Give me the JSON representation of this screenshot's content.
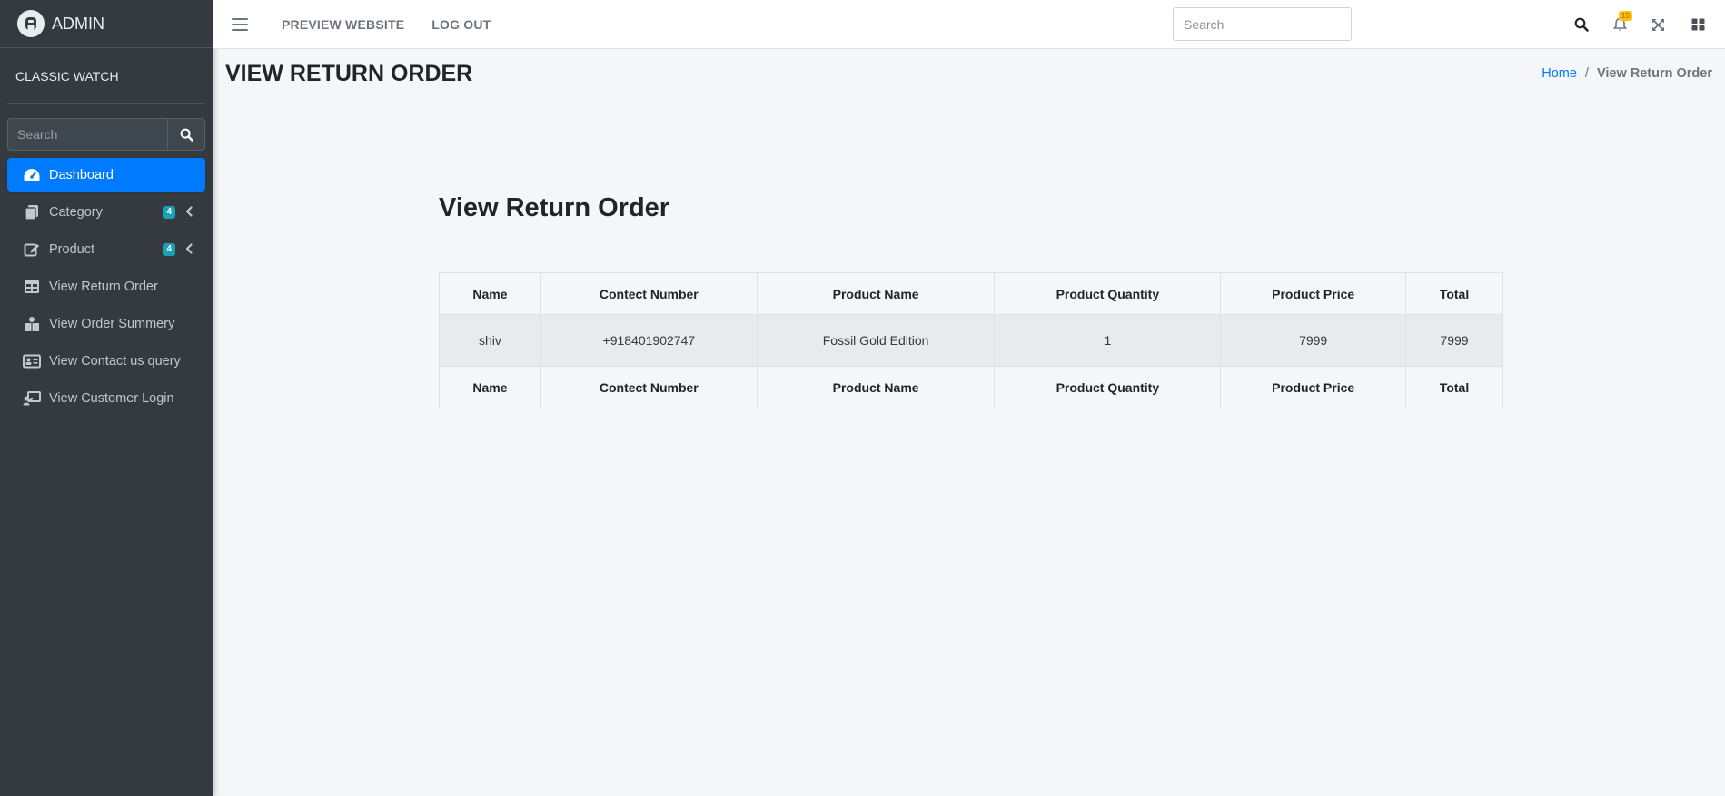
{
  "sidebar": {
    "brand": "ADMIN",
    "user": "CLASSIC WATCH",
    "search_placeholder": "Search",
    "items": [
      {
        "label": "Dashboard",
        "icon": "tachometer-icon",
        "active": true
      },
      {
        "label": "Category",
        "icon": "copy-icon",
        "badge": "4"
      },
      {
        "label": "Product",
        "icon": "edit-icon",
        "badge": "4"
      },
      {
        "label": "View Return Order",
        "icon": "table-icon"
      },
      {
        "label": "View Order Summery",
        "icon": "boxes-icon"
      },
      {
        "label": "View Contact us query",
        "icon": "address-card-icon"
      },
      {
        "label": "View Customer Login",
        "icon": "chalkboard-teacher-icon"
      }
    ]
  },
  "topbar": {
    "preview_label": "PREVIEW WEBSITE",
    "logout_label": "LOG OUT",
    "search_placeholder": "Search",
    "notification_count": "15"
  },
  "page": {
    "title": "VIEW RETURN ORDER",
    "breadcrumb_home": "Home",
    "breadcrumb_current": "View Return Order",
    "section_title": "View Return Order"
  },
  "table": {
    "headers": [
      "Name",
      "Contect Number",
      "Product Name",
      "Product Quantity",
      "Product Price",
      "Total"
    ],
    "rows": [
      [
        "shiv",
        "+918401902747",
        "Fossil Gold Edition",
        "1",
        "7999",
        "7999"
      ]
    ]
  },
  "colors": {
    "sidebar_bg": "#343a40",
    "accent": "#007bff",
    "badge": "#17a2b8",
    "notification_badge": "#ffc107"
  }
}
